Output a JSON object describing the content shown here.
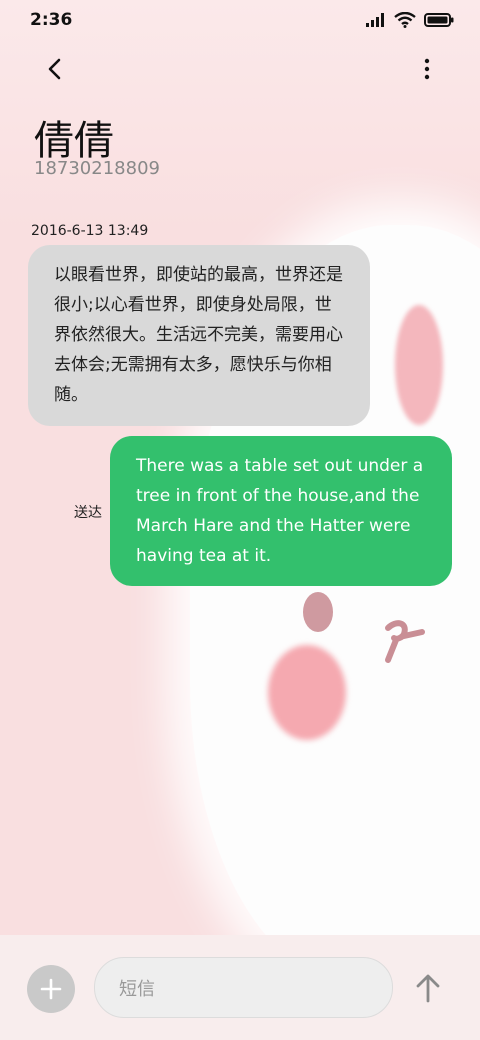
{
  "status_bar": {
    "time": "2:36"
  },
  "contact": {
    "name": "倩倩",
    "number": "18730218809"
  },
  "conversation": {
    "timestamp": "2016-6-13 13:49",
    "incoming_text": "以眼看世界，即使站的最高，世界还是很小;以心看世界，即使身处局限，世界依然很大。生活远不完美，需要用心去体会;无需拥有太多，愿快乐与你相随。",
    "outgoing_text": "There was a table set out under a tree in front of the house,and the March Hare and the Hatter were having tea at it.",
    "sent_status": "送达"
  },
  "composer": {
    "placeholder": "短信"
  },
  "colors": {
    "outgoing_bubble": "#33c06d",
    "incoming_bubble": "#d9d9d9"
  },
  "icons": [
    "signal-icon",
    "wifi-icon",
    "battery-icon",
    "back-arrow-icon",
    "more-vertical-icon",
    "plus-icon",
    "send-arrow-icon"
  ]
}
